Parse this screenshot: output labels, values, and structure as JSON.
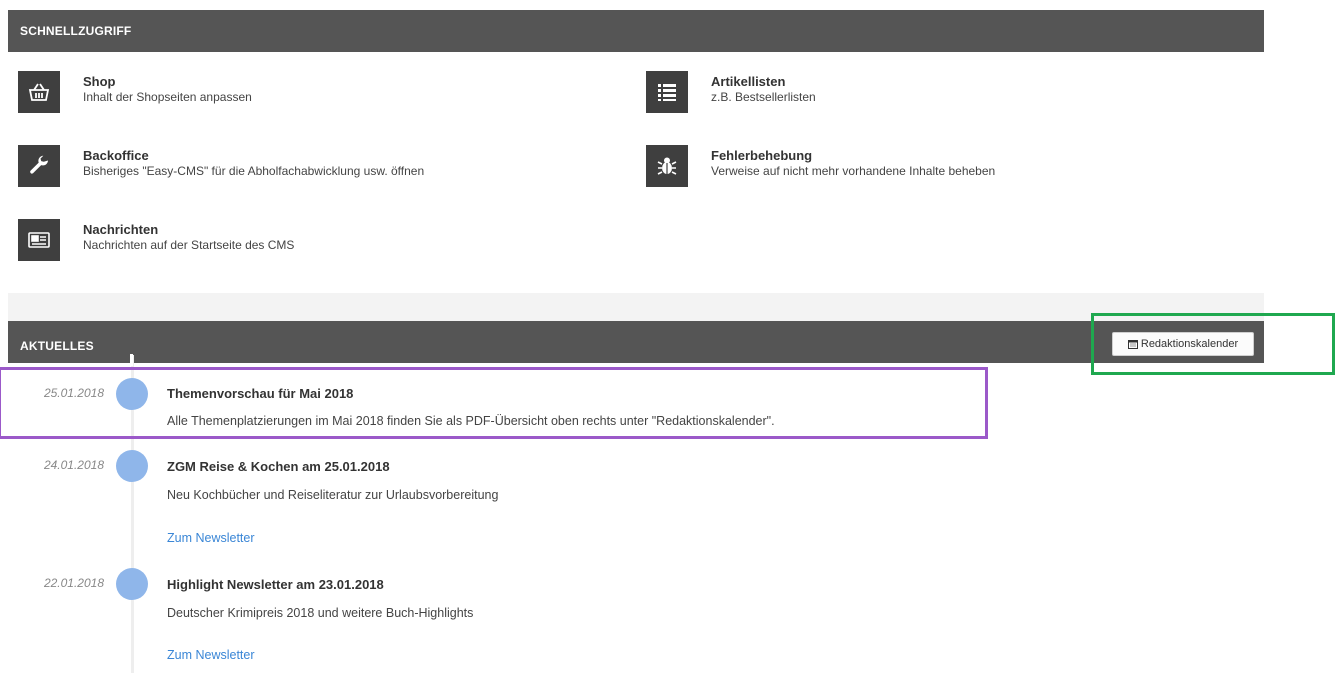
{
  "quick_access": {
    "header": "SCHNELLZUGRIFF",
    "items": [
      {
        "title": "Shop",
        "desc": "Inhalt der Shopseiten anpassen",
        "icon": "shopping-basket-icon"
      },
      {
        "title": "Artikellisten",
        "desc": "z.B. Bestsellerlisten",
        "icon": "list-icon"
      },
      {
        "title": "Backoffice",
        "desc": "Bisheriges \"Easy-CMS\" für die Abholfachabwicklung usw. öffnen",
        "icon": "wrench-icon"
      },
      {
        "title": "Fehlerbehebung",
        "desc": "Verweise auf nicht mehr vorhandene Inhalte beheben",
        "icon": "bug-icon"
      },
      {
        "title": "Nachrichten",
        "desc": "Nachrichten auf der Startseite des CMS",
        "icon": "newspaper-icon"
      }
    ]
  },
  "news": {
    "header": "AKTUELLES",
    "calendar_button": "Redaktionskalender",
    "calendar_icon": "calendar-icon",
    "entries": [
      {
        "date": "25.01.2018",
        "title": "Themenvorschau für Mai 2018",
        "text": "Alle Themenplatzierungen im Mai 2018 finden Sie als PDF-Übersicht oben rechts unter \"Redaktionskalender\".",
        "link": ""
      },
      {
        "date": "24.01.2018",
        "title": "ZGM Reise & Kochen am 25.01.2018",
        "text": "Neu Kochbücher und Reiseliteratur zur Urlaubsvorbereitung",
        "link": "Zum Newsletter"
      },
      {
        "date": "22.01.2018",
        "title": "Highlight Newsletter am 23.01.2018",
        "text": "Deutscher Krimipreis 2018 und weitere Buch-Highlights",
        "link": "Zum Newsletter"
      }
    ]
  },
  "colors": {
    "header_bar": "#555555",
    "icon_tile": "#3f3f3f",
    "timeline_dot": "#8fb6ea",
    "link": "#3a86d6",
    "highlight_green": "#1fa84f",
    "highlight_purple": "#9b59c9"
  }
}
